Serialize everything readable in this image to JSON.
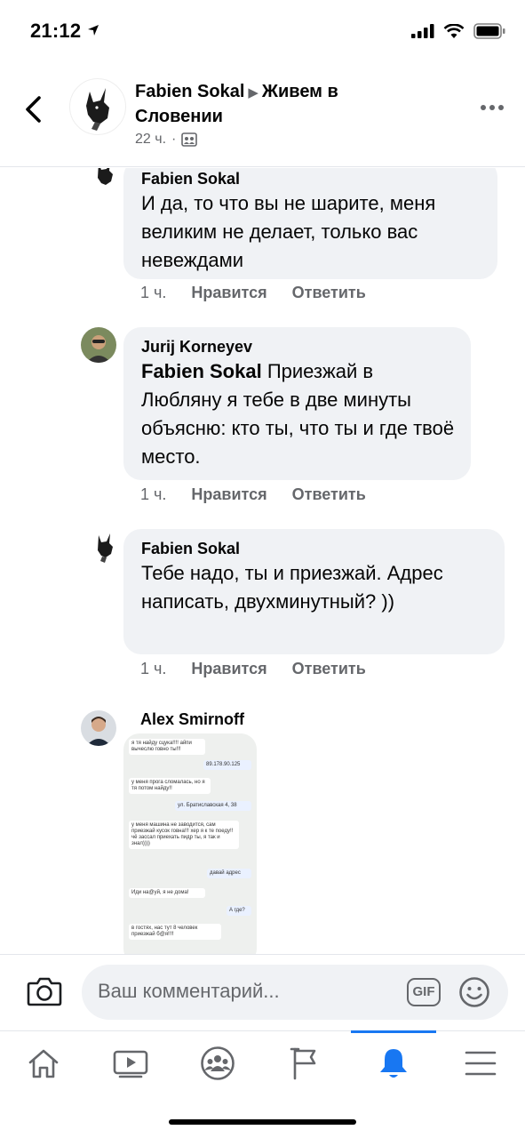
{
  "status_bar": {
    "time": "21:12"
  },
  "header": {
    "author": "Fabien  Sokal",
    "group": "Живем в Словении",
    "time": "22 ч."
  },
  "comments": [
    {
      "author": "Fabien  Sokal",
      "text": "И да, то что вы не шарите, меня великим не делает, только вас невеждами",
      "time": "1 ч.",
      "like": "Нравится",
      "reply": "Ответить"
    },
    {
      "author": "Jurij Korneyev",
      "mention": "Fabien  Sokal",
      "text": "Приезжай в Любляну я тебе в две минуты объясню: кто ты, что ты и где твоё место.",
      "time": "1 ч.",
      "like": "Нравится",
      "reply": "Ответить"
    },
    {
      "author": "Fabien  Sokal",
      "text": "Тебе надо, ты и приезжай. Адрес написать, двухминутный? ))",
      "time": "1 ч.",
      "like": "Нравится",
      "reply": "Ответить"
    },
    {
      "author": "Alex Smirnoff",
      "screenshot_messages": [
        "я тя найду сцука!!!! айпи вычеслю говно ты!!!",
        "89.178.90.125",
        "у меня прога сломалась, но я тя потом найду!!",
        "ул. Братиславская 4, 38",
        "у меня машина не заводится, сам приезжай кусок говна!!! хер я к те поеду!! чё зассал приехать пидр ты, я так и знал))))",
        "давай адрес",
        "Иди на@уй, я не дома!",
        "А где?",
        "в гостях, нас тут 8 человек приезжай б@я!!!!"
      ]
    }
  ],
  "composer": {
    "placeholder": "Ваш комментарий...",
    "gif_label": "GIF"
  },
  "tabs": [
    "home-icon",
    "video-icon",
    "groups-icon",
    "pages-icon",
    "notifications-icon",
    "menu-icon"
  ],
  "colors": {
    "accent": "#1877f2",
    "bubble": "#f0f2f5",
    "muted": "#65676b"
  }
}
